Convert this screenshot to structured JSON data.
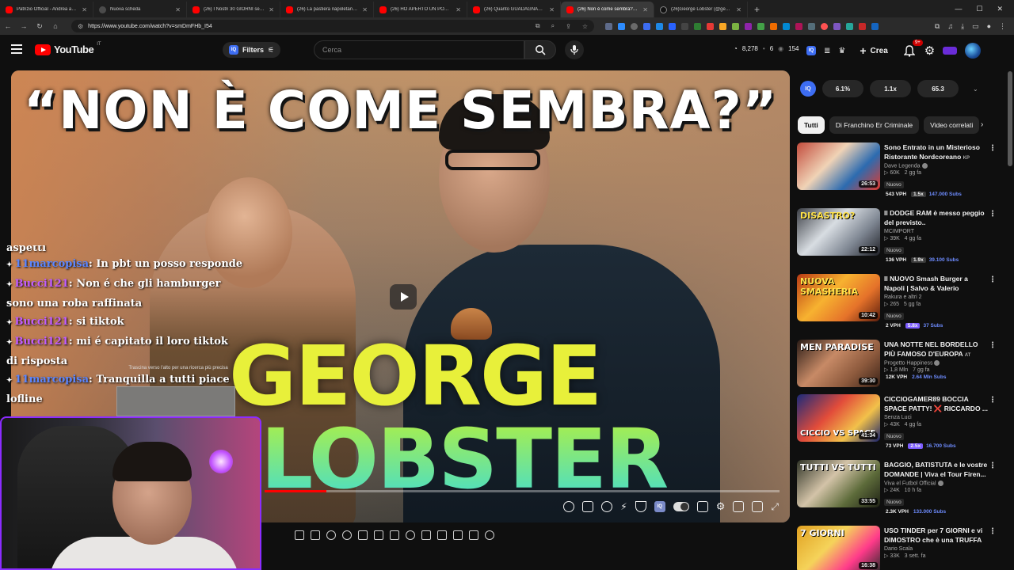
{
  "browser": {
    "tabs": [
      {
        "title": "Patrizio Official - Andrea amaro",
        "icon": "youtube-favicon"
      },
      {
        "title": "Nuova scheda",
        "icon": "globe-favicon"
      },
      {
        "title": "(26) I Nostri 30 GIORNI senza C",
        "icon": "youtube-favicon"
      },
      {
        "title": "(26) La pastiera napoletana sen",
        "icon": "youtube-favicon"
      },
      {
        "title": "(26) HO APERTO UN POP-UP C",
        "icon": "youtube-favicon"
      },
      {
        "title": "(26) Quanto GUADAGNANO gli",
        "icon": "youtube-favicon"
      },
      {
        "title": "(26) Non è come sembra? GEO",
        "icon": "youtube-favicon",
        "active": true
      },
      {
        "title": "(26)George Lobster (@georgel",
        "icon": "tiktok-favicon"
      }
    ],
    "url": "https://www.youtube.com/watch?v=smDmFHb_I54"
  },
  "header": {
    "logo_text": "YouTube",
    "logo_country": "IT",
    "filters_label": "Filters",
    "search_placeholder": "Cerca",
    "stats": {
      "views": "8,278",
      "mid": "6",
      "eye": "154"
    },
    "create_label": "Crea",
    "notif_badge": "9+"
  },
  "video": {
    "thumb_title": "“NON È COME SEMBRA?”",
    "big_line1": "GEORGE",
    "big_line2": "LOBSTER",
    "drag_hint": "Trascina verso l'alto per una ricerca più precisa",
    "progress": 0.12
  },
  "chat": [
    {
      "kind": "text",
      "text": "aspetti"
    },
    {
      "user": "11marcopisa",
      "text": ": In pbt un posso responde",
      "color": "blue"
    },
    {
      "user": "Bucci121",
      "text": ": Non é che gli hamburger",
      "color": "purple"
    },
    {
      "kind": "text",
      "text": "sono una roba raffinata"
    },
    {
      "user": "Bucci121",
      "text": ": si tiktok",
      "color": "purple"
    },
    {
      "user": "Bucci121",
      "text": ": mi é capitato il loro tiktok",
      "color": "purple"
    },
    {
      "kind": "text",
      "text": "di risposta"
    },
    {
      "user": "11marcopisa",
      "text": ": Tranquilla a tutti piace",
      "color": "blue"
    },
    {
      "kind": "text",
      "text": "lofline"
    }
  ],
  "rail": {
    "metrics": [
      "6.1%",
      "1.1x",
      "65.3"
    ],
    "chips": [
      "Tutti",
      "Di Franchino Er Criminale",
      "Video correlati"
    ],
    "items": [
      {
        "title": "Sono Entrato in un Misterioso Ristorante Nordcoreano",
        "suffix": "KP",
        "channel": "Dave Legenda",
        "verified": true,
        "views": "60K",
        "age": "2 gg fa",
        "new": "Nuovo",
        "vph": "543 VPH",
        "ratio": "1.5x",
        "ratio_hot": false,
        "subs": "147.000 Subs",
        "duration": "26:53"
      },
      {
        "title": "Il DODGE RAM è messo peggio del previsto..",
        "suffix": "",
        "channel": "MCIMPORT",
        "verified": false,
        "views": "39K",
        "age": "4 gg fa",
        "new": "Nuovo",
        "vph": "136 VPH",
        "ratio": "1.9x",
        "ratio_hot": false,
        "subs": "39.100 Subs",
        "duration": "22:12",
        "thumb_text": "DISASTRO?"
      },
      {
        "title": "Il NUOVO Smash Burger a Napoli | Salvo & Valerio",
        "suffix": "",
        "channel": "Rakura e altri 2",
        "verified": false,
        "views": "265",
        "age": "5 gg fa",
        "new": "Nuovo",
        "vph": "2 VPH",
        "ratio": "5.8x",
        "ratio_hot": true,
        "subs": "37 Subs",
        "duration": "10:42",
        "thumb_text": "NUOVA SMASHERIA"
      },
      {
        "title": "UNA NOTTE NEL BORDELLO PIÙ FAMOSO D'EUROPA",
        "suffix": "AT",
        "channel": "Progetto Happiness",
        "verified": true,
        "views": "1,8 Mln",
        "age": "7 gg fa",
        "new": "",
        "vph": "12K VPH",
        "ratio": "",
        "ratio_hot": false,
        "subs": "2.64 Mln Subs",
        "duration": "39:30",
        "thumb_text": "MEN PARADISE"
      },
      {
        "title": "CICCIOGAMER89 BOCCIA SPACE PATTY! ❌ RICCARDO ...",
        "suffix": "",
        "channel": "Senza Luci",
        "verified": false,
        "views": "43K",
        "age": "4 gg fa",
        "new": "Nuovo",
        "vph": "73 VPH",
        "ratio": "2.5x",
        "ratio_hot": true,
        "subs": "16.700 Subs",
        "duration": "41:34",
        "thumb_text": "CICCIO VS SPACE"
      },
      {
        "title": "BAGGIO, BATISTUTA e le vostre DOMANDE | Viva el Tour Firen...",
        "suffix": "",
        "channel": "Viva el Futbol Official",
        "verified": true,
        "views": "24K",
        "age": "10 h fa",
        "new": "Nuovo",
        "vph": "2.3K VPH",
        "ratio": "",
        "ratio_hot": false,
        "subs": "133.000 Subs",
        "duration": "33:55",
        "thumb_text": "TUTTI VS TUTTI"
      },
      {
        "title": "USO TINDER per 7 GIORNI e vi DIMOSTRO che è una TRUFFA",
        "suffix": "",
        "channel": "Dario Scala",
        "verified": false,
        "views": "33K",
        "age": "3 sett. fa",
        "new": "",
        "vph": "",
        "ratio": "",
        "ratio_hot": false,
        "subs": "",
        "duration": "16:38",
        "thumb_text": "7 GIORNI"
      }
    ]
  },
  "colors": {
    "accent": "#ff0000",
    "iq_blue": "#3d6df2",
    "subs_blue": "#6e8cff",
    "webcam_border": "#8b2cff"
  }
}
